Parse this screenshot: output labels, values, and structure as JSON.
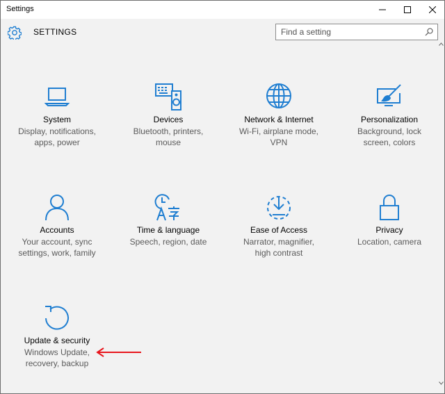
{
  "window": {
    "title": "Settings"
  },
  "header": {
    "title": "SETTINGS",
    "search_placeholder": "Find a setting",
    "search_value": ""
  },
  "colors": {
    "accent": "#1f7ed1",
    "annotation_arrow": "#e8141b"
  },
  "tiles": [
    {
      "title": "System",
      "desc1": "Display, notifications,",
      "desc2": "apps, power",
      "icon": "laptop-icon"
    },
    {
      "title": "Devices",
      "desc1": "Bluetooth, printers,",
      "desc2": "mouse",
      "icon": "devices-icon"
    },
    {
      "title": "Network & Internet",
      "desc1": "Wi-Fi, airplane mode,",
      "desc2": "VPN",
      "icon": "globe-icon"
    },
    {
      "title": "Personalization",
      "desc1": "Background, lock",
      "desc2": "screen, colors",
      "icon": "paintbrush-icon"
    },
    {
      "title": "Accounts",
      "desc1": "Your account, sync",
      "desc2": "settings, work, family",
      "icon": "person-icon"
    },
    {
      "title": "Time & language",
      "desc1": "Speech, region, date",
      "desc2": "",
      "icon": "time-language-icon"
    },
    {
      "title": "Ease of Access",
      "desc1": "Narrator, magnifier,",
      "desc2": "high contrast",
      "icon": "ease-of-access-icon"
    },
    {
      "title": "Privacy",
      "desc1": "Location, camera",
      "desc2": "",
      "icon": "lock-icon"
    },
    {
      "title": "Update & security",
      "desc1": "Windows Update,",
      "desc2": "recovery, backup",
      "icon": "update-icon"
    }
  ]
}
